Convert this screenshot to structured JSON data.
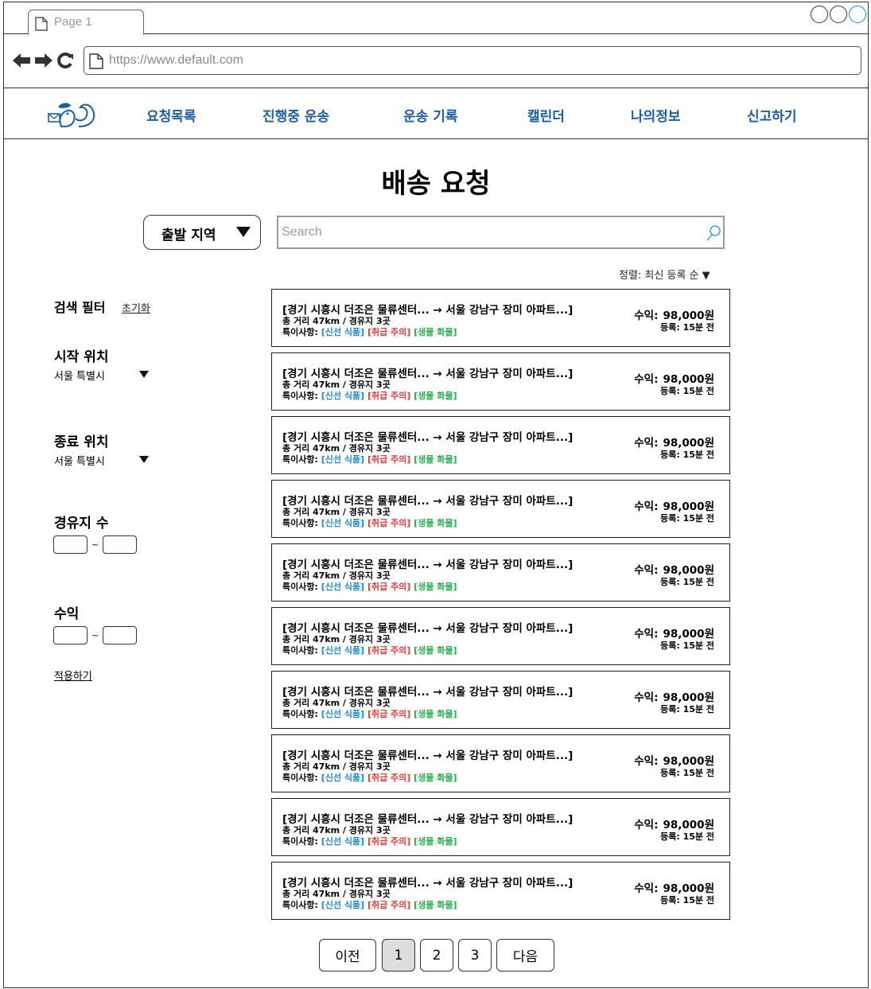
{
  "browser": {
    "tab_title": "Page 1",
    "url": "https://www.default.com"
  },
  "nav": {
    "items": [
      "요청목록",
      "진행중 운송",
      "운송 기록",
      "캘린더",
      "나의정보",
      "신고하기"
    ],
    "color": "#1b5ea8"
  },
  "page": {
    "title": "배송 요청"
  },
  "search": {
    "region_label": "출발 지역",
    "placeholder": "Search",
    "value": ""
  },
  "sort": {
    "label": "정렬: 최신 등록 순 ▼"
  },
  "filter": {
    "title": "검색 필터",
    "reset": "초기화",
    "start_label": "시작 위치",
    "start_value": "서울 특별시",
    "end_label": "종료 위치",
    "end_value": "서울 특별시",
    "waypoints_label": "경유지 수",
    "income_label": "수익",
    "tilde": "~",
    "apply": "적용하기"
  },
  "cards": [
    {
      "route": "[경기 시흥시 더조은 물류센터... → 서울 강남구 장미 아파트...]",
      "dist": "총 거리 47km / 경유지 3곳",
      "note_label": "특이사항: ",
      "tag1": "[신선 식품]",
      "tag2": "[취급 주의]",
      "tag3": "[생물 화물]",
      "earn_label": "수익:",
      "earn_value": "98,000원",
      "posted": "등록: 15분 전"
    },
    {
      "route": "[경기 시흥시 더조은 물류센터... → 서울 강남구 장미 아파트...]",
      "dist": "총 거리 47km / 경유지 3곳",
      "note_label": "특이사항: ",
      "tag1": "[신선 식품]",
      "tag2": "[취급 주의]",
      "tag3": "[생물 화물]",
      "earn_label": "수익:",
      "earn_value": "98,000원",
      "posted": "등록: 15분 전"
    },
    {
      "route": "[경기 시흥시 더조은 물류센터... → 서울 강남구 장미 아파트...]",
      "dist": "총 거리 47km / 경유지 3곳",
      "note_label": "특이사항: ",
      "tag1": "[신선 식품]",
      "tag2": "[취급 주의]",
      "tag3": "[생물 화물]",
      "earn_label": "수익:",
      "earn_value": "98,000원",
      "posted": "등록: 15분 전"
    },
    {
      "route": "[경기 시흥시 더조은 물류센터... → 서울 강남구 장미 아파트...]",
      "dist": "총 거리 47km / 경유지 3곳",
      "note_label": "특이사항: ",
      "tag1": "[신선 식품]",
      "tag2": "[취급 주의]",
      "tag3": "[생물 화물]",
      "earn_label": "수익:",
      "earn_value": "98,000원",
      "posted": "등록: 15분 전"
    },
    {
      "route": "[경기 시흥시 더조은 물류센터... → 서울 강남구 장미 아파트...]",
      "dist": "총 거리 47km / 경유지 3곳",
      "note_label": "특이사항: ",
      "tag1": "[신선 식품]",
      "tag2": "[취급 주의]",
      "tag3": "[생물 화물]",
      "earn_label": "수익:",
      "earn_value": "98,000원",
      "posted": "등록: 15분 전"
    },
    {
      "route": "[경기 시흥시 더조은 물류센터... → 서울 강남구 장미 아파트...]",
      "dist": "총 거리 47km / 경유지 3곳",
      "note_label": "특이사항: ",
      "tag1": "[신선 식품]",
      "tag2": "[취급 주의]",
      "tag3": "[생물 화물]",
      "earn_label": "수익:",
      "earn_value": "98,000원",
      "posted": "등록: 15분 전"
    },
    {
      "route": "[경기 시흥시 더조은 물류센터... → 서울 강남구 장미 아파트...]",
      "dist": "총 거리 47km / 경유지 3곳",
      "note_label": "특이사항: ",
      "tag1": "[신선 식품]",
      "tag2": "[취급 주의]",
      "tag3": "[생물 화물]",
      "earn_label": "수익:",
      "earn_value": "98,000원",
      "posted": "등록: 15분 전"
    },
    {
      "route": "[경기 시흥시 더조은 물류센터... → 서울 강남구 장미 아파트...]",
      "dist": "총 거리 47km / 경유지 3곳",
      "note_label": "특이사항: ",
      "tag1": "[신선 식품]",
      "tag2": "[취급 주의]",
      "tag3": "[생물 화물]",
      "earn_label": "수익:",
      "earn_value": "98,000원",
      "posted": "등록: 15분 전"
    },
    {
      "route": "[경기 시흥시 더조은 물류센터... → 서울 강남구 장미 아파트...]",
      "dist": "총 거리 47km / 경유지 3곳",
      "note_label": "특이사항: ",
      "tag1": "[신선 식품]",
      "tag2": "[취급 주의]",
      "tag3": "[생물 화물]",
      "earn_label": "수익:",
      "earn_value": "98,000원",
      "posted": "등록: 15분 전"
    },
    {
      "route": "[경기 시흥시 더조은 물류센터... → 서울 강남구 장미 아파트...]",
      "dist": "총 거리 47km / 경유지 3곳",
      "note_label": "특이사항: ",
      "tag1": "[신선 식품]",
      "tag2": "[취급 주의]",
      "tag3": "[생물 화물]",
      "earn_label": "수익:",
      "earn_value": "98,000원",
      "posted": "등록: 15분 전"
    }
  ],
  "tag_colors": {
    "fresh": "#1e88e5",
    "caution": "#e53935",
    "live": "#21b24b"
  },
  "pagination": {
    "prev": "이전",
    "pages": [
      "1",
      "2",
      "3"
    ],
    "current": "1",
    "next": "다음"
  }
}
